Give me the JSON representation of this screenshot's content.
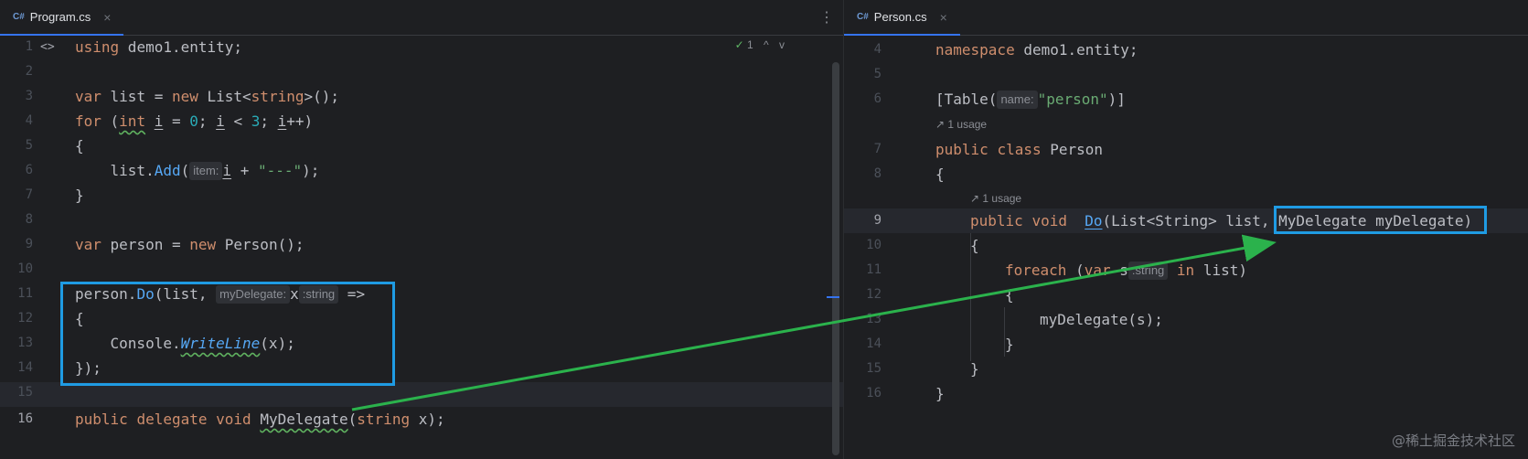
{
  "left_editor": {
    "tab": {
      "icon": "C#",
      "name": "Program.cs",
      "close": "×"
    },
    "menu_icon": "⋮",
    "status": {
      "check": "✓",
      "count": "1",
      "up": "^",
      "down": "v"
    },
    "fold_icon": "<>",
    "line_numbers": [
      "1",
      "2",
      "3",
      "4",
      "5",
      "6",
      "7",
      "8",
      "9",
      "10",
      "11",
      "12",
      "13",
      "14",
      "15",
      "16"
    ],
    "code": {
      "l1_kw": "using",
      "l1_rest": " demo1.entity;",
      "l3_kw": "var",
      "l3_a": " list = ",
      "l3_new": "new",
      "l3_b": " List<",
      "l3_type": "string",
      "l3_c": ">();",
      "l4_kw": "for",
      "l4_a": " (",
      "l4_int": "int",
      "l4_b": " ",
      "l4_i1": "i",
      "l4_c": " = ",
      "l4_zero": "0",
      "l4_d": "; ",
      "l4_i2": "i",
      "l4_e": " < ",
      "l4_three": "3",
      "l4_f": "; ",
      "l4_i3": "i",
      "l4_g": "++)",
      "l5": "{",
      "l6_a": "    list.",
      "l6_fn": "Add",
      "l6_b": "(",
      "l6_hint": "item:",
      "l6_i": "i",
      "l6_c": " + ",
      "l6_str": "\"---\"",
      "l6_d": ");",
      "l7": "}",
      "l9_kw": "var",
      "l9_a": " person = ",
      "l9_new": "new",
      "l9_b": " Person();",
      "l11_a": "person.",
      "l11_fn": "Do",
      "l11_b": "(list, ",
      "l11_hint": "myDelegate:",
      "l11_x": "x",
      "l11_type": ":string",
      "l11_c": " =>",
      "l12": "{",
      "l13_a": "    Console.",
      "l13_fn": "WriteLine",
      "l13_b": "(x);",
      "l14": "});",
      "l16_kw1": "public",
      "l16_kw2": "delegate",
      "l16_kw3": "void",
      "l16_name": "MyDelegate",
      "l16_a": "(",
      "l16_type": "string",
      "l16_b": " x);"
    }
  },
  "right_editor": {
    "tab": {
      "icon": "C#",
      "name": "Person.cs",
      "close": "×"
    },
    "line_numbers": [
      "4",
      "5",
      "6",
      "7",
      "8",
      "9",
      "10",
      "11",
      "12",
      "13",
      "14",
      "15",
      "16"
    ],
    "usage_labels": [
      "1 usage",
      "1 usage"
    ],
    "code": {
      "l4_kw": "namespace",
      "l4_rest": " demo1.entity;",
      "l6_a": "[Table(",
      "l6_hint": "name:",
      "l6_str": "\"person\"",
      "l6_b": ")]",
      "l7_kw1": "public",
      "l7_kw2": "class",
      "l7_rest": " Person",
      "l8": "{",
      "l9_kw1": "public",
      "l9_kw2": "void",
      "l9_fn": "Do",
      "l9_a": "(List<String> list, ",
      "l9_param": "MyDelegate myDelegate",
      "l9_b": ")",
      "l10": "{",
      "l11_kw": "foreach",
      "l11_a": " (",
      "l11_var": "var",
      "l11_s": " s",
      "l11_type": ":string",
      "l11_in": "in",
      "l11_b": " list)",
      "l12": "{",
      "l13": "myDelegate(s);",
      "l14": "}",
      "l15": "}",
      "l16": "}"
    }
  },
  "watermark": "@稀土掘金技术社区",
  "colors": {
    "highlight_box": "#1f9be3",
    "arrow": "#2bb24c",
    "keyword": "#cf8e6d",
    "string": "#6aab73",
    "method": "#56a8f5"
  }
}
